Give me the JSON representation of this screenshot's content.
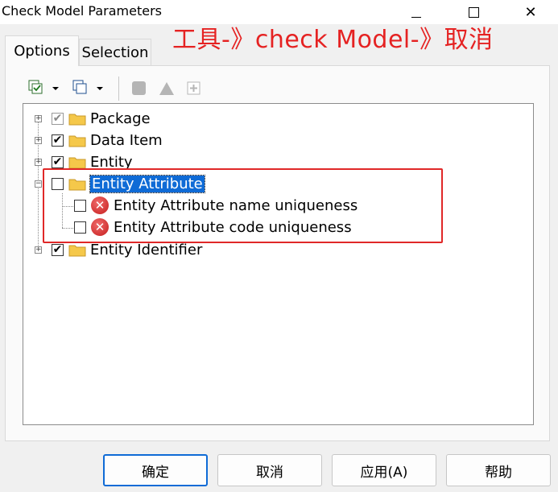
{
  "window": {
    "title": "Check Model Parameters",
    "minimize_label": "",
    "maximize_label": "",
    "close_label": "✕"
  },
  "annotation": {
    "text": "工具-》check Model-》取消",
    "color": "#e52222"
  },
  "tabs": [
    {
      "label": "Options",
      "active": true
    },
    {
      "label": "Selection",
      "active": false
    }
  ],
  "tree": {
    "items": [
      {
        "label": "Package",
        "checked": "partial",
        "expanded": false
      },
      {
        "label": "Data Item",
        "checked": true,
        "expanded": false
      },
      {
        "label": "Entity",
        "checked": true,
        "expanded": false
      },
      {
        "label": "Entity Attribute",
        "checked": false,
        "expanded": true,
        "selected": true,
        "children": [
          {
            "label": "Entity Attribute name uniqueness",
            "checked": false,
            "icon": "error-icon"
          },
          {
            "label": "Entity Attribute code uniqueness",
            "checked": false,
            "icon": "error-icon"
          }
        ]
      },
      {
        "label": "Entity Identifier",
        "checked": true,
        "expanded": false
      }
    ]
  },
  "buttons": {
    "ok": "确定",
    "cancel": "取消",
    "apply": "应用(A)",
    "help": "帮助"
  },
  "colors": {
    "selection": "#0f6bd6",
    "highlight_box": "#e02828",
    "folder": "#f5c84a"
  }
}
